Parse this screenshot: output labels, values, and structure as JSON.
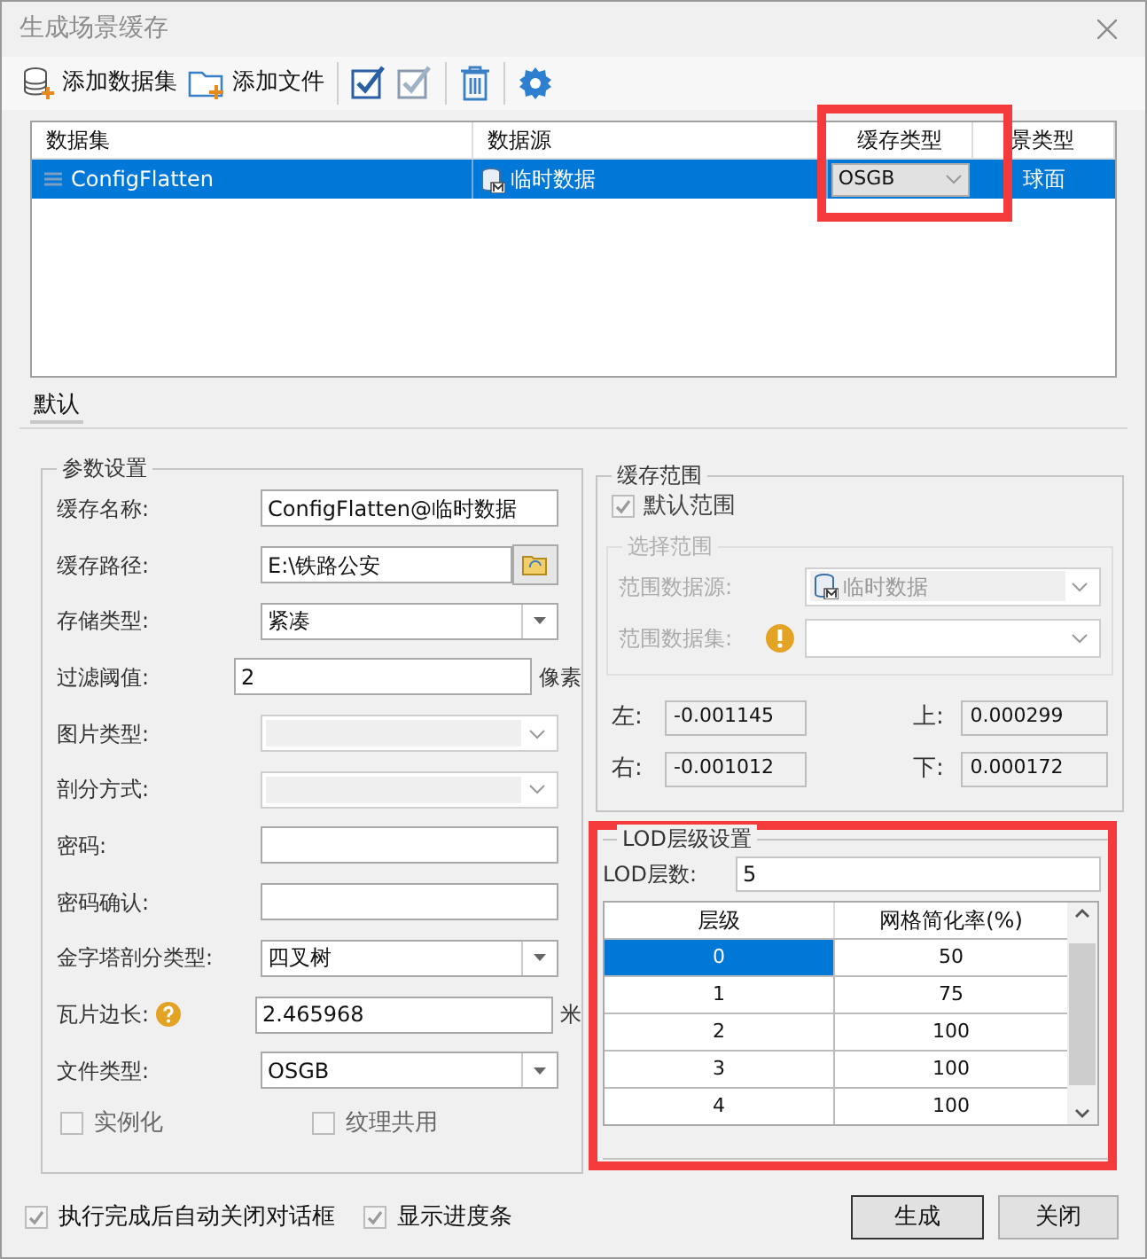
{
  "window": {
    "title": "生成场景缓存"
  },
  "toolbar": [
    {
      "kind": "add-dataset",
      "label": "添加数据集"
    },
    {
      "kind": "add-file",
      "label": "添加文件"
    },
    {
      "kind": "select-all"
    },
    {
      "kind": "select-invert"
    },
    {
      "kind": "delete"
    },
    {
      "kind": "settings"
    }
  ],
  "dataset_table": {
    "columns": [
      "数据集",
      "数据源",
      "缓存类型",
      "景类型"
    ],
    "rows": [
      {
        "selected": true,
        "dataset": "ConfigFlatten",
        "datasource": "临时数据",
        "cache_type": "OSGB",
        "scene_type": "球面"
      }
    ]
  },
  "tabs": [
    {
      "label": "默认",
      "selected": true
    }
  ],
  "params": {
    "title": "参数设置",
    "fields": [
      {
        "kind": "text",
        "label": "缓存名称:",
        "value": "ConfigFlatten@临时数据"
      },
      {
        "kind": "path",
        "label": "缓存路径:",
        "value": "E:\\铁路公安"
      },
      {
        "kind": "combo",
        "label": "存储类型:",
        "value": "紧凑"
      },
      {
        "kind": "text",
        "label": "过滤阈值:",
        "value": "2",
        "unit": "像素"
      },
      {
        "kind": "disabled-combo",
        "label": "图片类型:"
      },
      {
        "kind": "disabled-combo",
        "label": "剖分方式:"
      },
      {
        "kind": "text",
        "label": "密码:"
      },
      {
        "kind": "text",
        "label": "密码确认:"
      },
      {
        "kind": "combo",
        "label": "金字塔剖分类型:",
        "value": "四叉树"
      },
      {
        "kind": "text",
        "label": "瓦片边长:",
        "value": "2.465968",
        "unit": "米",
        "help": true
      },
      {
        "kind": "combo",
        "label": "文件类型:",
        "value": "OSGB"
      }
    ],
    "checkboxes": [
      {
        "label": "实例化",
        "checked": false
      },
      {
        "label": "纹理共用",
        "checked": false
      }
    ]
  },
  "range": {
    "title": "缓存范围",
    "default_range": {
      "label": "默认范围",
      "checked": true
    },
    "select_range": {
      "title": "选择范围",
      "source_label": "范围数据源:",
      "source_value": "临时数据",
      "dataset_label": "范围数据集:"
    },
    "bounds": [
      {
        "label": "左:",
        "value": "-0.001145"
      },
      {
        "label": "上:",
        "value": "0.000299"
      },
      {
        "label": "右:",
        "value": "-0.001012"
      },
      {
        "label": "下:",
        "value": "0.000172"
      }
    ]
  },
  "lod": {
    "title": "LOD层级设置",
    "count_label": "LOD层数:",
    "count": "5",
    "columns": [
      "层级",
      "网格简化率(%)"
    ],
    "rows": [
      {
        "level": "0",
        "rate": "50",
        "selected": true
      },
      {
        "level": "1",
        "rate": "75",
        "selected": false
      },
      {
        "level": "2",
        "rate": "100",
        "selected": false
      },
      {
        "level": "3",
        "rate": "100",
        "selected": false
      },
      {
        "level": "4",
        "rate": "100",
        "selected": false
      }
    ]
  },
  "footer": {
    "checkboxes": [
      {
        "label": "执行完成后自动关闭对话框",
        "checked": true
      },
      {
        "label": "显示进度条",
        "checked": true
      }
    ],
    "buttons": [
      "生成",
      "关闭"
    ]
  }
}
